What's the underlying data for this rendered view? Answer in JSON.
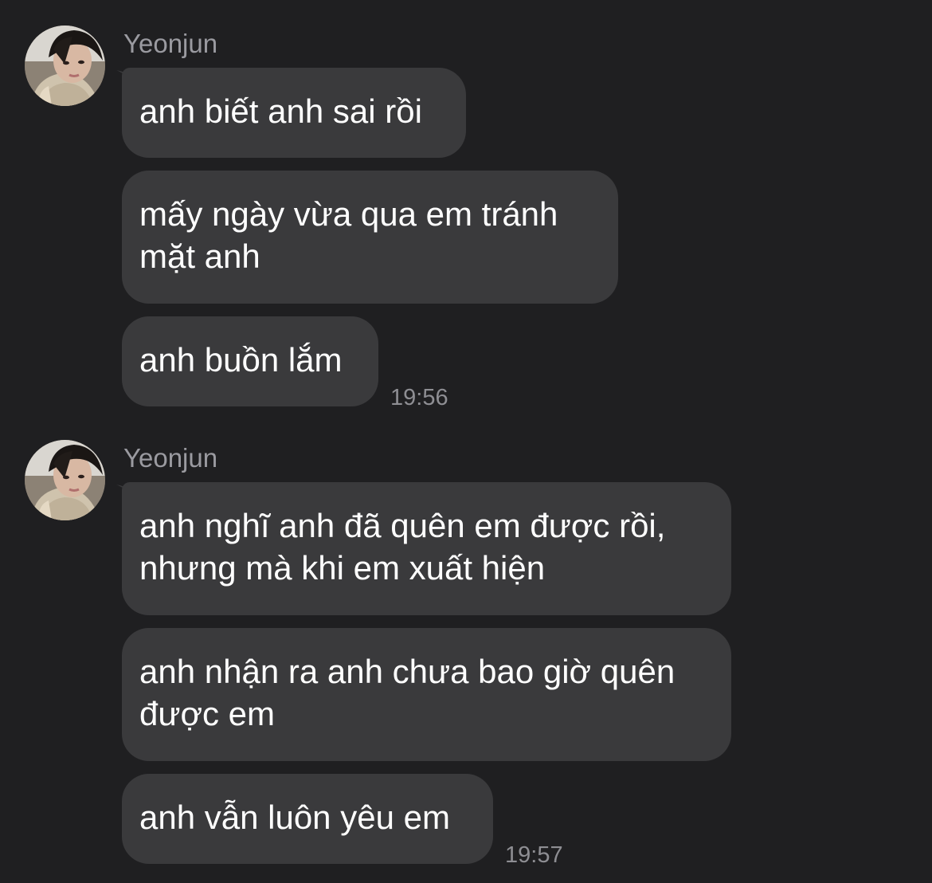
{
  "groups": [
    {
      "sender": "Yeonjun",
      "avatar_icon": "user-avatar-photo",
      "messages": [
        {
          "text": "anh biết anh sai rồi"
        },
        {
          "text": "mấy ngày vừa qua em tránh mặt anh",
          "lines": [
            "mấy ngày vừa qua em tránh",
            "mặt anh"
          ]
        },
        {
          "text": "anh buồn lắm"
        }
      ],
      "time": "19:56"
    },
    {
      "sender": "Yeonjun",
      "avatar_icon": "user-avatar-photo",
      "messages": [
        {
          "text": "anh nghĩ anh đã quên em được rồi, nhưng mà khi em xuất hiện",
          "lines": [
            "anh nghĩ anh đã quên em được rồi,",
            "nhưng mà khi em xuất hiện"
          ]
        },
        {
          "text": "anh nhận ra anh chưa bao giờ quên được em",
          "lines": [
            "anh nhận ra anh chưa bao giờ quên",
            "được em"
          ]
        },
        {
          "text": "anh vẫn luôn yêu em"
        }
      ],
      "time": "19:57"
    }
  ],
  "colors": {
    "background": "#1f1f21",
    "bubble": "#3a3a3c",
    "sender": "#9a9aa0",
    "timestamp": "#8e8e93",
    "text": "#ffffff"
  }
}
